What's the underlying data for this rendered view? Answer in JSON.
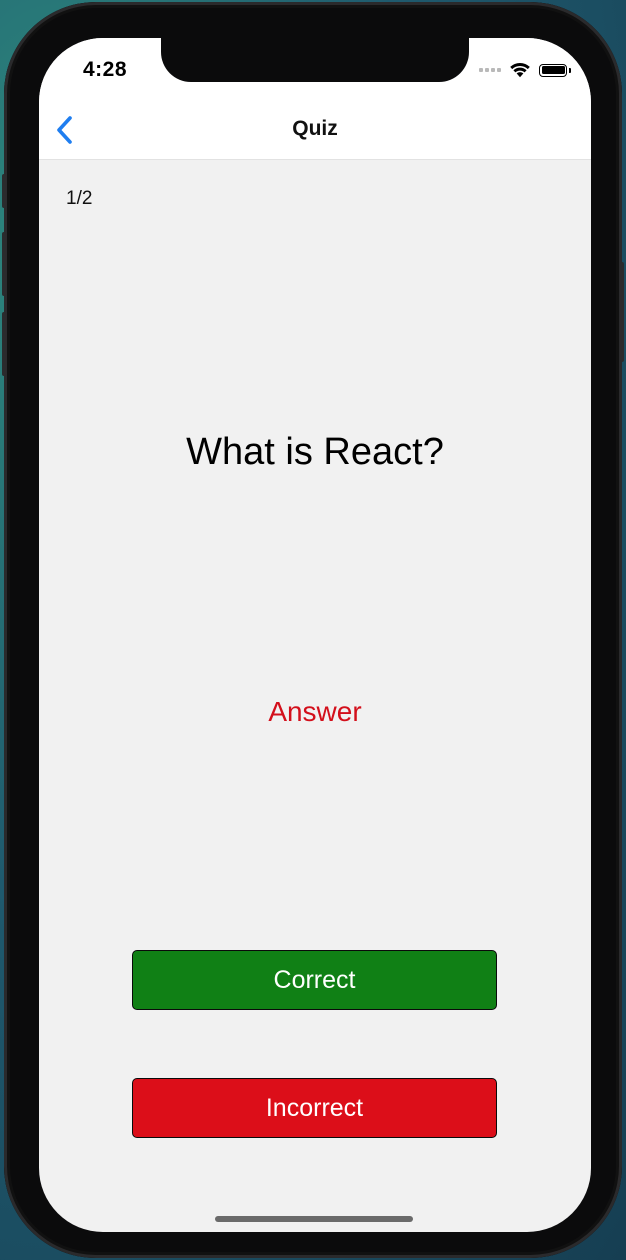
{
  "status_bar": {
    "time": "4:28",
    "icons": [
      "cellular-signal-icon",
      "wifi-icon",
      "battery-icon"
    ]
  },
  "nav": {
    "back_icon": "chevron-left-icon",
    "title": "Quiz"
  },
  "quiz": {
    "counter": "1/2",
    "question": "What is React?",
    "answer_label": "Answer",
    "correct_label": "Correct",
    "incorrect_label": "Incorrect"
  },
  "colors": {
    "accent_blue": "#1f7ef0",
    "answer_red": "#d30f1b",
    "correct_green": "#108015",
    "incorrect_red": "#dc0e19",
    "screen_bg": "#f1f1f1"
  }
}
